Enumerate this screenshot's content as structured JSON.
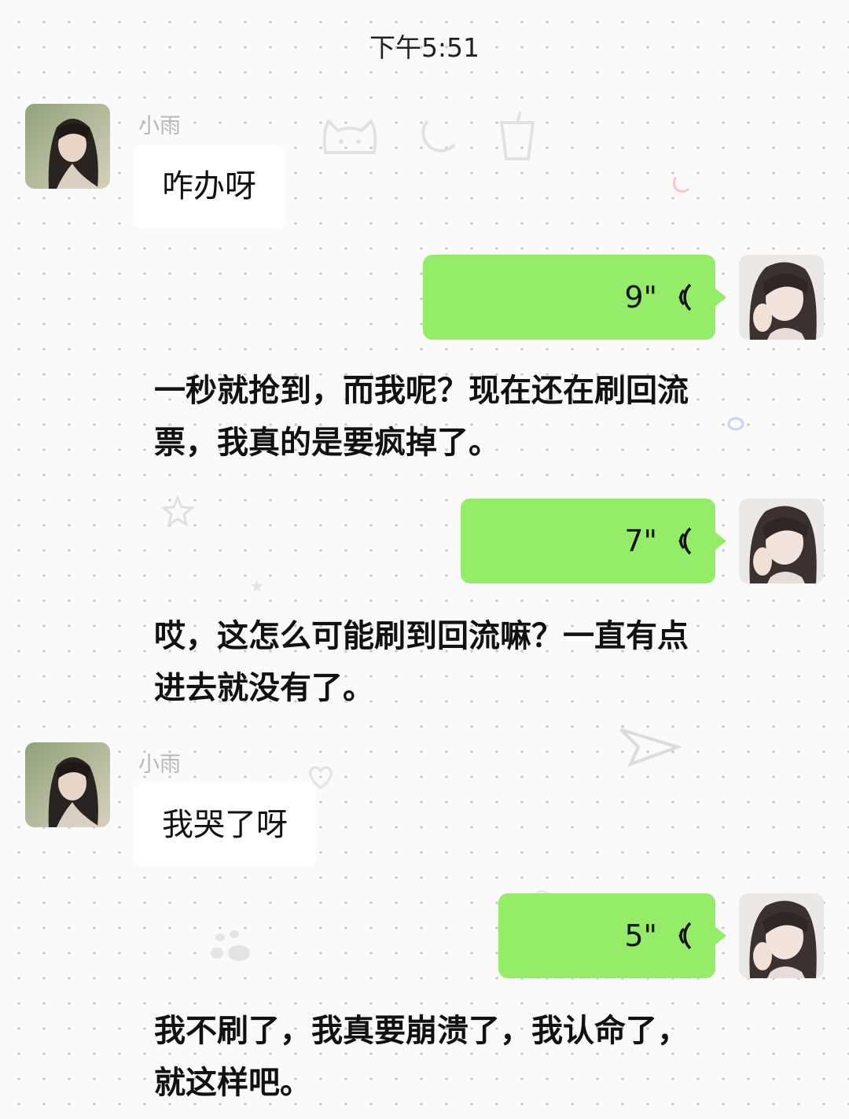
{
  "status": {
    "time": "下午5:51"
  },
  "messages": [
    {
      "sender": "小雨",
      "text": "咋办呀"
    },
    {
      "voice_duration": "9\""
    },
    {
      "caption": "一秒就抢到，而我呢？现在还在刷回流票，我真的是要疯掉了。"
    },
    {
      "voice_duration": "7\""
    },
    {
      "caption": "哎，这怎么可能刷到回流嘛？一直有点进去就没有了。"
    },
    {
      "sender": "小雨",
      "text": "我哭了呀"
    },
    {
      "voice_duration": "5\""
    },
    {
      "caption": "我不刷了，我真要崩溃了，我认命了，就这样吧。"
    }
  ],
  "colors": {
    "voice_bubble": "#95ec69",
    "text_bubble": "#ffffff",
    "sender_name": "#b8b8b8"
  },
  "icons": {
    "voice": "voice-wave-icon",
    "doodles": [
      "cat-face-doodle",
      "moon-doodle",
      "cup-doodle",
      "star-doodle",
      "heart-doodle",
      "paw-doodle"
    ]
  }
}
